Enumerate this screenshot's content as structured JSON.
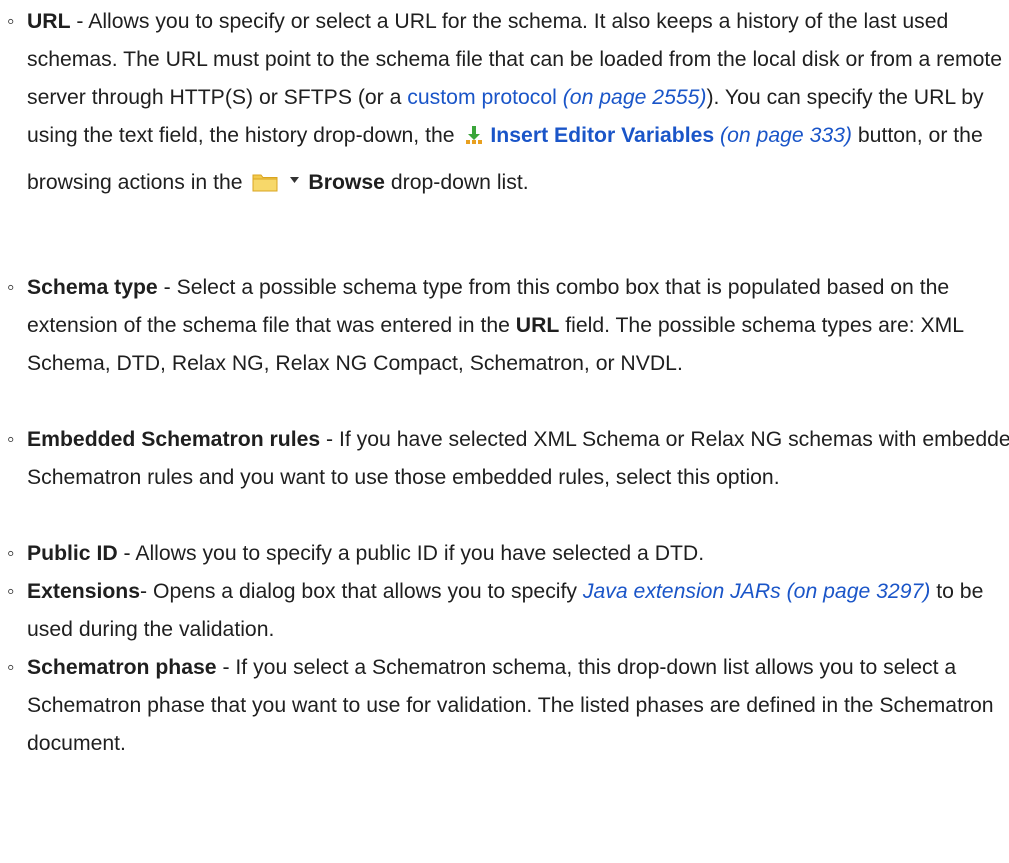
{
  "items": [
    {
      "term": "URL",
      "sep": " - ",
      "text1": "Allows you to specify or select a URL for the schema. It also keeps a history of the last used schemas. The URL must point to the schema file that can be loaded from the local disk or from a remote server through HTTP(S) or SFTPS (or a ",
      "link1": "custom protocol",
      "ref1": "(on page 2555)",
      "text2": "). You can specify the URL by using the text field, the history drop-down, the ",
      "insert_icon": "insert-editor-variables-icon",
      "link2": "Insert Editor Variables",
      "ref2": "(on page 333)",
      "text3": " button, or the browsing actions in the ",
      "browse_icon": "folder-icon",
      "browse_caret_icon": "caret-down-icon",
      "browse_label": "Browse",
      "text4": " drop-down list."
    },
    {
      "term": "Schema type",
      "sep": " - ",
      "text1": "Select a possible schema type from this combo box that is populated based on the extension of the schema file that was entered in the ",
      "bold1": "URL",
      "text2": " field. The possible schema types are: XML Schema, DTD, Relax NG, Relax NG Compact, Schematron, or NVDL."
    },
    {
      "term": "Embedded Schematron rules",
      "sep": " - ",
      "text1": "If you have selected XML Schema or Relax NG schemas with embedded Schematron rules and you want to use those embedded rules, select this option."
    },
    {
      "term": "Public ID",
      "sep": " - ",
      "text1": "Allows you to specify a public ID if you have selected a DTD."
    },
    {
      "term": "Extensions",
      "sep": "- ",
      "text1": "Opens a dialog box that allows you to specify ",
      "ref1": "Java extension JARs (on page 3297)",
      "text2": " to be used during the validation."
    },
    {
      "term": "Schematron phase",
      "sep": " - ",
      "text1": "If you select a Schematron schema, this drop-down list allows you to select a Schematron phase that you want to use for validation. The listed phases are defined in the Schematron document."
    }
  ],
  "bullet_symbol": "◦",
  "colors": {
    "text": "#1f1f1f",
    "link": "#1a55c8",
    "folder": "#f2c94c",
    "insert_icon_green": "#3aa53a",
    "insert_icon_orange": "#e8a020"
  }
}
